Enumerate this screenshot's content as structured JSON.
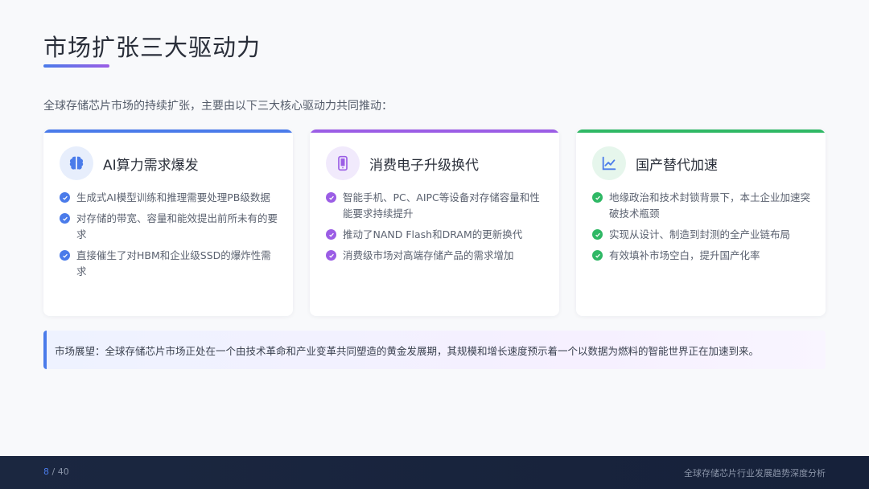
{
  "slide": {
    "title": "市场扩张三大驱动力",
    "intro": "全球存储芯片市场的持续扩张，主要由以下三大核心驱动力共同推动："
  },
  "colors": {
    "blue": "#4a7bea",
    "purple": "#9b5de5",
    "green": "#2fb865"
  },
  "cards": [
    {
      "title": "AI算力需求爆发",
      "icon": "brain-icon",
      "accent": "#4a7bea",
      "items": [
        "生成式AI模型训练和推理需要处理PB级数据",
        "对存储的带宽、容量和能效提出前所未有的要求",
        "直接催生了对HBM和企业级SSD的爆炸性需求"
      ]
    },
    {
      "title": "消费电子升级换代",
      "icon": "smartphone-icon",
      "accent": "#9b5de5",
      "items": [
        "智能手机、PC、AIPC等设备对存储容量和性能要求持续提升",
        "推动了NAND Flash和DRAM的更新换代",
        "消费级市场对高端存储产品的需求增加"
      ]
    },
    {
      "title": "国产替代加速",
      "icon": "trend-chart-icon",
      "accent": "#2fb865",
      "items": [
        "地缘政治和技术封锁背景下，本土企业加速突破技术瓶颈",
        "实现从设计、制造到封测的全产业链布局",
        "有效填补市场空白，提升国产化率"
      ]
    }
  ],
  "note": "市场展望：全球存储芯片市场正处在一个由技术革命和产业变革共同塑造的黄金发展期，其规模和增长速度预示着一个以数据为燃料的智能世界正在加速到来。",
  "footer": {
    "current_page": "8",
    "total_pages": "/ 40",
    "title": "全球存储芯片行业发展趋势深度分析"
  }
}
